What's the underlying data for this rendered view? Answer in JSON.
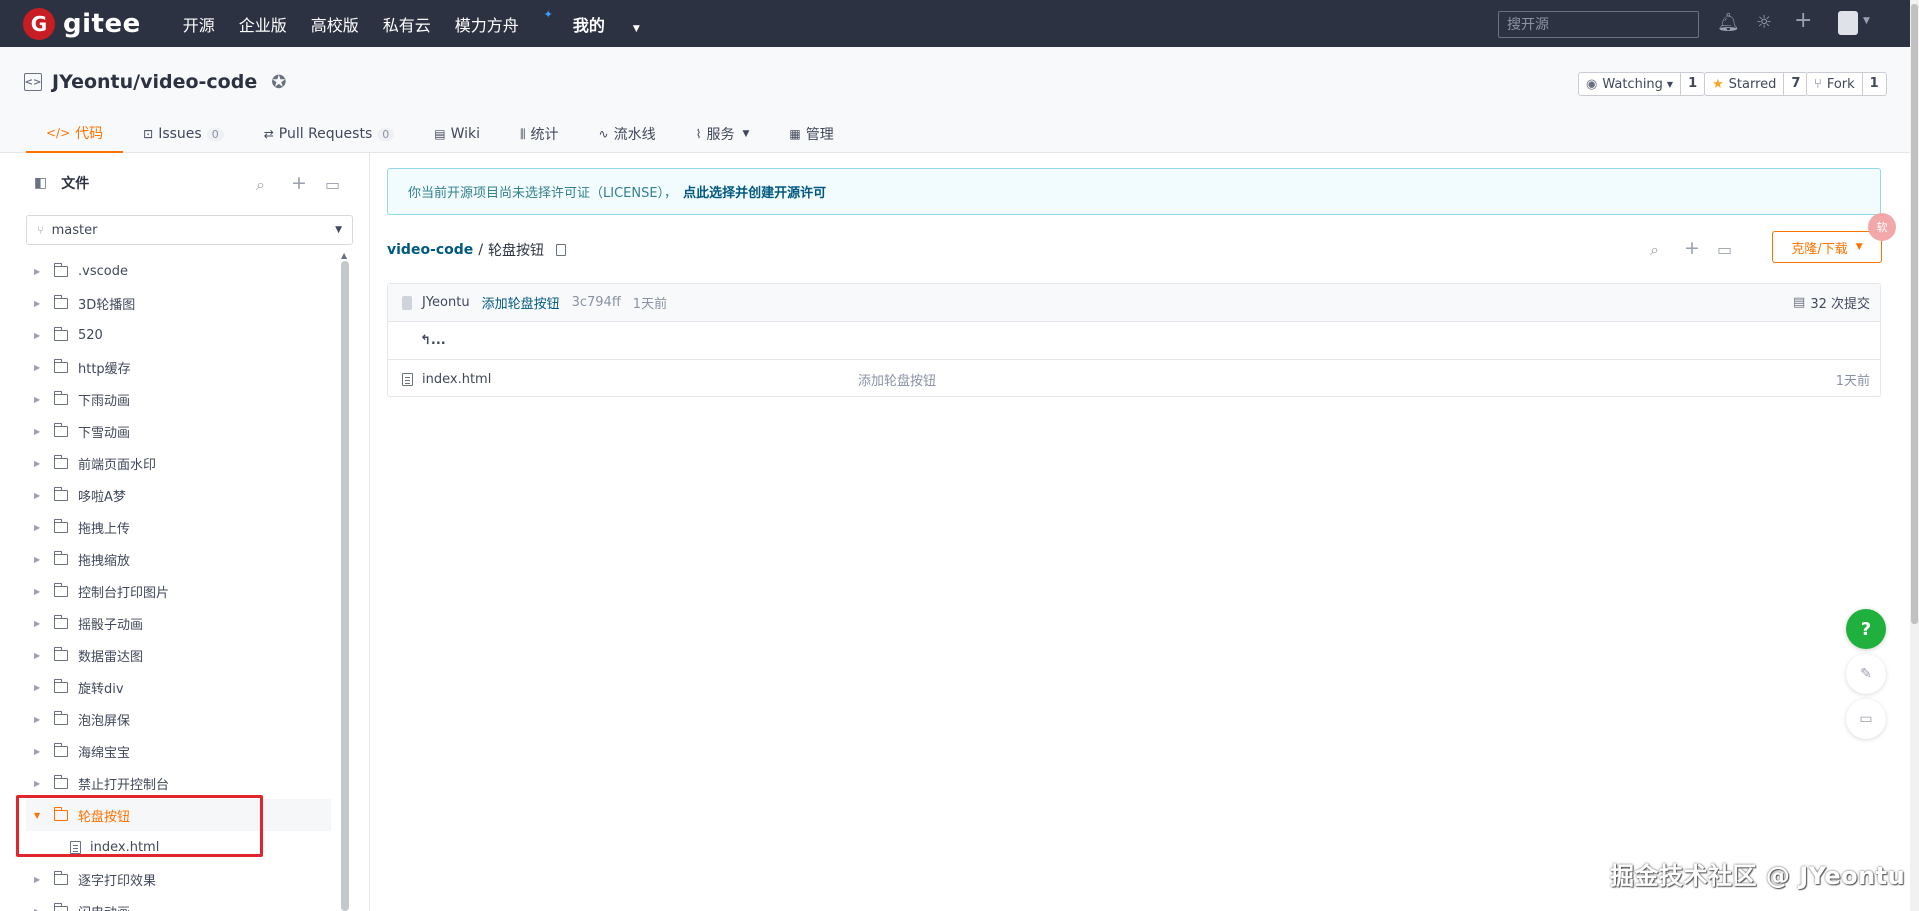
{
  "nav": {
    "logo_text": "gitee",
    "logo_letter": "G",
    "links": [
      "开源",
      "企业版",
      "高校版",
      "私有云",
      "模力方舟",
      "我的"
    ],
    "search_placeholder": "搜开源"
  },
  "repo": {
    "title": "JYeontu/video-code",
    "watching_label": "Watching",
    "watching_count": "1",
    "starred_label": "Starred",
    "starred_count": "7",
    "fork_label": "Fork",
    "fork_count": "1"
  },
  "tabs": [
    {
      "label": "代码",
      "count": ""
    },
    {
      "label": "Issues",
      "count": "0"
    },
    {
      "label": "Pull Requests",
      "count": "0"
    },
    {
      "label": "Wiki",
      "count": ""
    },
    {
      "label": "统计",
      "count": ""
    },
    {
      "label": "流水线",
      "count": ""
    },
    {
      "label": "服务",
      "count": ""
    },
    {
      "label": "管理",
      "count": ""
    }
  ],
  "sidebar": {
    "title": "文件",
    "branch": "master",
    "tree": [
      ".vscode",
      "3D轮播图",
      "520",
      "http缓存",
      "下雨动画",
      "下雪动画",
      "前端页面水印",
      "哆啦A梦",
      "拖拽上传",
      "拖拽缩放",
      "控制台打印图片",
      "摇骰子动画",
      "数据雷达图",
      "旋转div",
      "泡泡屏保",
      "海绵宝宝",
      "禁止打开控制台",
      "轮盘按钮",
      "index.html",
      "逐字打印效果",
      "闪电动画"
    ]
  },
  "notice": {
    "text": "你当前开源项目尚未选择许可证（LICENSE），",
    "link": "点此选择并创建开源许可"
  },
  "breadcrumb": {
    "root": "video-code",
    "sep": "/",
    "current": "轮盘按钮"
  },
  "clone_label": "克隆/下载",
  "commit": {
    "author": "JYeontu",
    "message": "添加轮盘按钮",
    "sha": "3c794ff",
    "time": "1天前",
    "total": "32 次提交"
  },
  "files": {
    "up": "...",
    "rows": [
      {
        "name": "index.html",
        "message": "添加轮盘按钮",
        "time": "1天前"
      }
    ]
  },
  "float_help": "?",
  "float_pink": "软",
  "watermark": "掘金技术社区 @ JYeontu",
  "colors": {
    "accent": "#fe7300",
    "nav_bg": "#2c3242",
    "highlight": "#e0262c"
  }
}
